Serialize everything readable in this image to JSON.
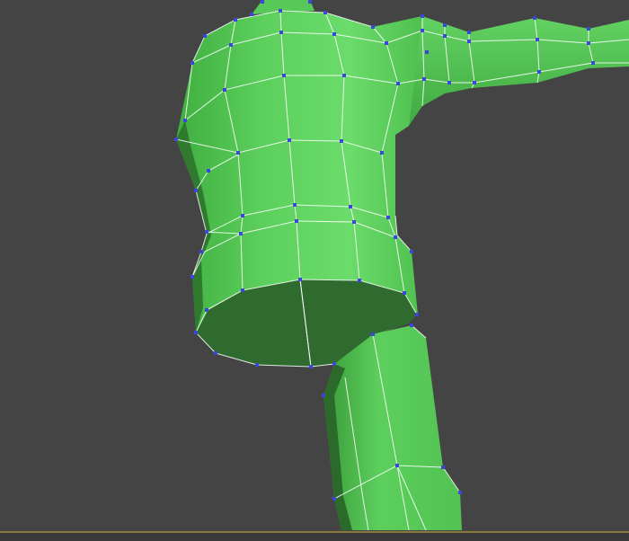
{
  "viewport": {
    "background_color": "#444444",
    "mesh_color": "#5ccf5c",
    "mesh_shadow_color": "#2e6a2e",
    "edge_color": "#ffffff",
    "vertex_color": "#3b47d6",
    "selection_mode": "vertex"
  }
}
